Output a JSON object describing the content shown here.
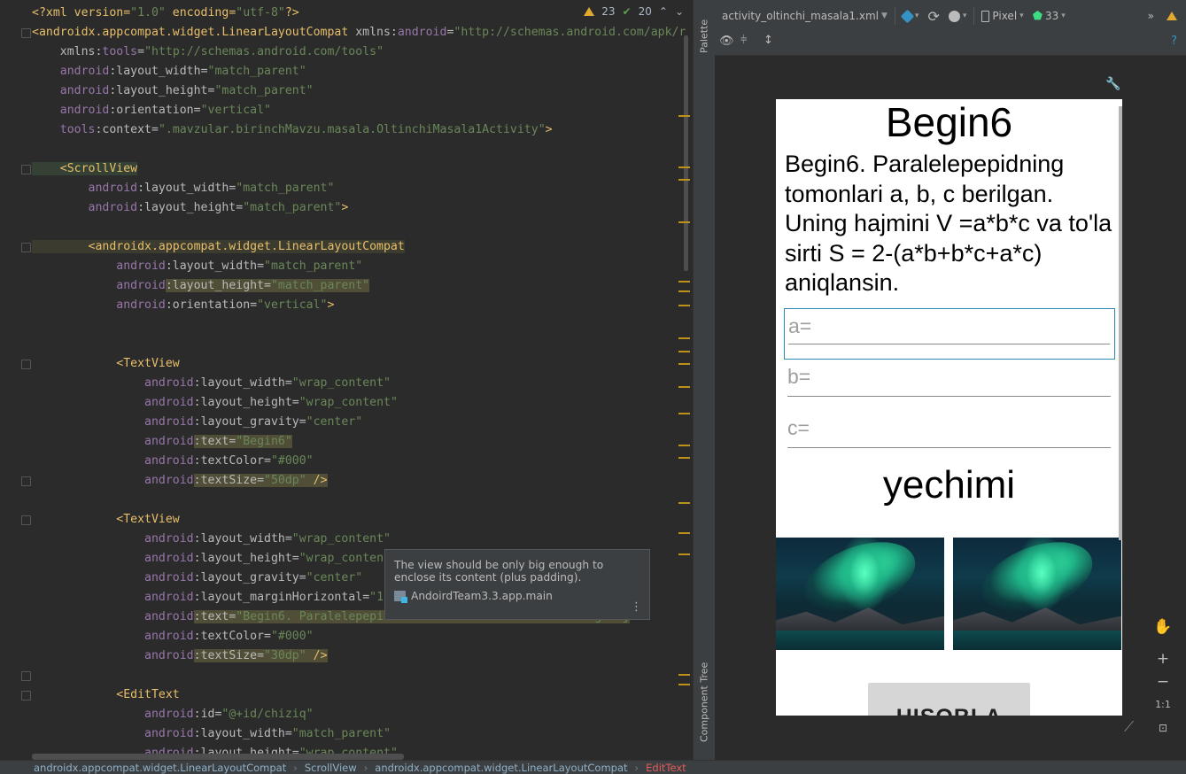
{
  "editor": {
    "lines": [
      {
        "parts": [
          [
            "pi",
            "<?xml version="
          ],
          [
            "v",
            "\"1.0\""
          ],
          [
            "pi",
            " encoding="
          ],
          [
            "v",
            "\"utf-8\""
          ],
          [
            "pi",
            "?>"
          ]
        ]
      },
      {
        "parts": [
          [
            "t",
            "<androidx.appcompat.widget.LinearLayoutCompat"
          ],
          [
            "at",
            " xmlns:"
          ],
          [
            "ns",
            "android"
          ],
          [
            "at",
            "="
          ],
          [
            "v",
            "\"http://schemas.android.com/apk/r"
          ]
        ]
      },
      {
        "parts": [
          [
            "at",
            "    xmlns:"
          ],
          [
            "ns",
            "tools"
          ],
          [
            "at",
            "="
          ],
          [
            "v",
            "\"http://schemas.android.com/tools\""
          ]
        ]
      },
      {
        "parts": [
          [
            "ns",
            "    android"
          ],
          [
            "at",
            ":layout_width"
          ],
          [
            "at",
            "="
          ],
          [
            "v",
            "\"match_parent\""
          ]
        ]
      },
      {
        "parts": [
          [
            "ns",
            "    android"
          ],
          [
            "at",
            ":layout_height"
          ],
          [
            "at",
            "="
          ],
          [
            "v",
            "\"match_parent\""
          ]
        ]
      },
      {
        "parts": [
          [
            "ns",
            "    android"
          ],
          [
            "at",
            ":orientation"
          ],
          [
            "at",
            "="
          ],
          [
            "v",
            "\"vertical\""
          ]
        ]
      },
      {
        "parts": [
          [
            "ns",
            "    tools"
          ],
          [
            "at",
            ":context"
          ],
          [
            "at",
            "="
          ],
          [
            "v",
            "\".mavzular.birinchMavzu.masala.OltinchiMasala1Activity\""
          ],
          [
            "t",
            ">"
          ]
        ]
      },
      {
        "parts": []
      },
      {
        "parts": [
          [
            "t",
            "    <ScrollView"
          ]
        ]
      },
      {
        "parts": [
          [
            "ns",
            "        android"
          ],
          [
            "at",
            ":layout_width"
          ],
          [
            "at",
            "="
          ],
          [
            "v",
            "\"match_parent\""
          ]
        ]
      },
      {
        "parts": [
          [
            "ns",
            "        android"
          ],
          [
            "at",
            ":layout_height"
          ],
          [
            "at",
            "="
          ],
          [
            "v",
            "\"match_parent\""
          ],
          [
            "t",
            ">"
          ]
        ]
      },
      {
        "parts": []
      },
      {
        "parts": [
          [
            "t",
            "        <androidx.appcompat.widget.LinearLayoutCompat"
          ]
        ]
      },
      {
        "parts": [
          [
            "ns",
            "            android"
          ],
          [
            "at",
            ":layout_width"
          ],
          [
            "at",
            "="
          ],
          [
            "v",
            "\"match_parent\""
          ]
        ]
      },
      {
        "parts": [
          [
            "ns",
            "            android"
          ],
          [
            "at",
            ":layout_height"
          ],
          [
            "at",
            "="
          ],
          [
            "v",
            "\"match_parent\""
          ]
        ]
      },
      {
        "parts": [
          [
            "ns",
            "            android"
          ],
          [
            "at",
            ":orientation"
          ],
          [
            "at",
            "="
          ],
          [
            "v",
            "\"vertical\""
          ],
          [
            "t",
            ">"
          ]
        ]
      },
      {
        "parts": []
      },
      {
        "parts": []
      },
      {
        "parts": [
          [
            "t",
            "            <TextView"
          ]
        ]
      },
      {
        "parts": [
          [
            "ns",
            "                android"
          ],
          [
            "at",
            ":layout_width"
          ],
          [
            "at",
            "="
          ],
          [
            "v",
            "\"wrap_content\""
          ]
        ]
      },
      {
        "parts": [
          [
            "ns",
            "                android"
          ],
          [
            "at",
            ":layout_height"
          ],
          [
            "at",
            "="
          ],
          [
            "v",
            "\"wrap_content\""
          ]
        ]
      },
      {
        "parts": [
          [
            "ns",
            "                android"
          ],
          [
            "at",
            ":layout_gravity"
          ],
          [
            "at",
            "="
          ],
          [
            "v",
            "\"center\""
          ]
        ]
      },
      {
        "parts": [
          [
            "ns",
            "                android"
          ],
          [
            "at",
            ":text"
          ],
          [
            "at",
            "="
          ],
          [
            "v",
            "\"Begin6\""
          ]
        ]
      },
      {
        "parts": [
          [
            "ns",
            "                android"
          ],
          [
            "at",
            ":textColor"
          ],
          [
            "at",
            "="
          ],
          [
            "v",
            "\"#000\""
          ]
        ]
      },
      {
        "parts": [
          [
            "ns",
            "                android"
          ],
          [
            "at",
            ":textSize"
          ],
          [
            "at",
            "="
          ],
          [
            "v",
            "\"50dp\""
          ],
          [
            "t",
            " />"
          ]
        ]
      },
      {
        "parts": []
      },
      {
        "parts": [
          [
            "t",
            "            <TextView"
          ]
        ]
      },
      {
        "parts": [
          [
            "ns",
            "                android"
          ],
          [
            "at",
            ":layout_width"
          ],
          [
            "at",
            "="
          ],
          [
            "v",
            "\"wrap_content\""
          ]
        ]
      },
      {
        "parts": [
          [
            "ns",
            "                android"
          ],
          [
            "at",
            ":layout_height"
          ],
          [
            "at",
            "="
          ],
          [
            "v",
            "\"wrap_content"
          ]
        ]
      },
      {
        "parts": [
          [
            "ns",
            "                android"
          ],
          [
            "at",
            ":layout_gravity"
          ],
          [
            "at",
            "="
          ],
          [
            "v",
            "\"center\""
          ]
        ]
      },
      {
        "parts": [
          [
            "ns",
            "                android"
          ],
          [
            "at",
            ":layout_marginHorizontal"
          ],
          [
            "at",
            "="
          ],
          [
            "v",
            "\"1"
          ]
        ]
      },
      {
        "parts": [
          [
            "ns",
            "                android"
          ],
          [
            "at",
            ":text"
          ],
          [
            "at",
            "="
          ],
          [
            "v",
            "\"Begin6. Paralelepepi"
          ],
          [
            "v",
            "                             ng haj"
          ]
        ]
      },
      {
        "parts": [
          [
            "ns",
            "                android"
          ],
          [
            "at",
            ":textColor"
          ],
          [
            "at",
            "="
          ],
          [
            "v",
            "\"#000\""
          ]
        ]
      },
      {
        "parts": [
          [
            "ns",
            "                android"
          ],
          [
            "at",
            ":textSize"
          ],
          [
            "at",
            "="
          ],
          [
            "v",
            "\"30dp\""
          ],
          [
            "t",
            " />"
          ]
        ]
      },
      {
        "parts": []
      },
      {
        "parts": [
          [
            "t",
            "            <EditText"
          ]
        ]
      },
      {
        "parts": [
          [
            "ns",
            "                android"
          ],
          [
            "at",
            ":id"
          ],
          [
            "at",
            "="
          ],
          [
            "v",
            "\"@+id/chiziq\""
          ]
        ]
      },
      {
        "parts": [
          [
            "ns",
            "                android"
          ],
          [
            "at",
            ":layout_width"
          ],
          [
            "at",
            "="
          ],
          [
            "v",
            "\"match_parent\""
          ]
        ]
      },
      {
        "parts": [
          [
            "ns",
            "                android"
          ],
          [
            "at",
            ":layout_height"
          ],
          [
            "at",
            "="
          ],
          [
            "v",
            "\"wrap_content\""
          ]
        ]
      }
    ],
    "inspection": {
      "warnings": "23",
      "weak_warnings": "20"
    },
    "tooltip": {
      "message": "The view should be only big enough to enclose its content (plus padding).",
      "source": "AndoirdTeam3.3.app.main"
    }
  },
  "side_tabs": {
    "palette": "Palette",
    "component_tree": "Component Tree"
  },
  "design": {
    "file_tab": "activity_oltinchi_masala1.xml",
    "device": "Pixel",
    "api": "33",
    "preview": {
      "title": "Begin6",
      "description": "Begin6. Paralelepepidning tomonlari a, b, c berilgan. Uning hajmini V =a*b*c va to'la sirti S = 2-(a*b+b*c+a*c) aniqlansin.",
      "hints": [
        "a=",
        "b=",
        "c="
      ],
      "result": "yechimi",
      "button": "HISOBLA"
    },
    "zoom": {
      "plus": "+",
      "minus": "−",
      "one": "1:1"
    }
  },
  "breadcrumb": [
    "androidx.appcompat.widget.LinearLayoutCompat",
    "ScrollView",
    "androidx.appcompat.widget.LinearLayoutCompat",
    "EditText"
  ]
}
